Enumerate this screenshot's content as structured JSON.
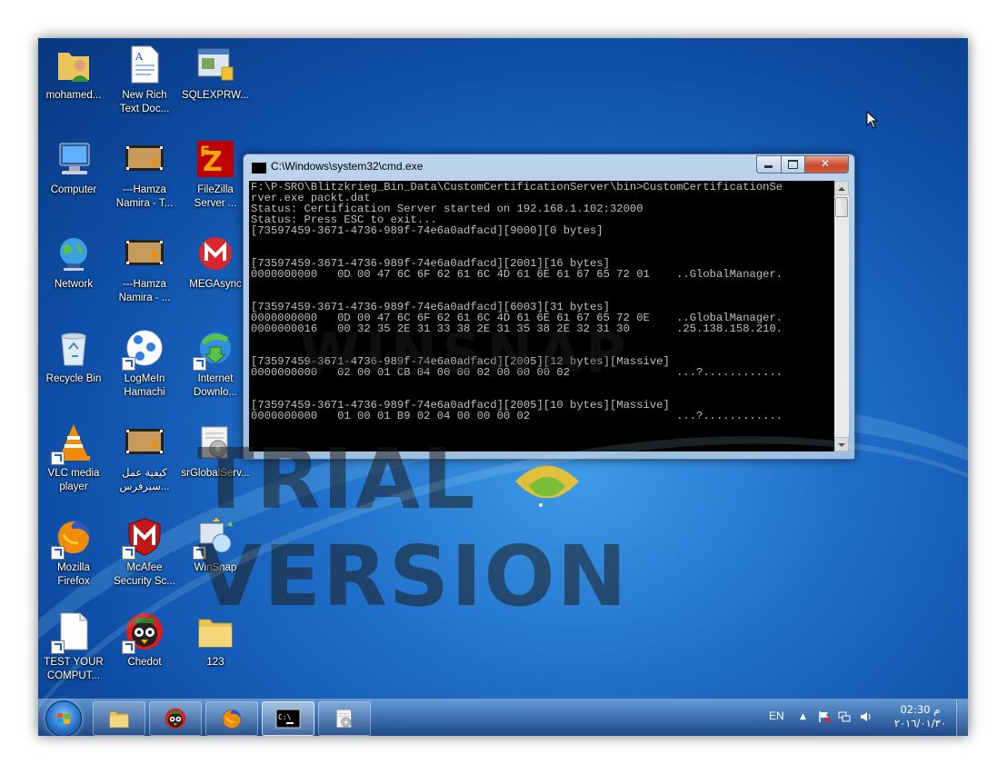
{
  "desktop": {
    "icons": [
      {
        "label": "mohamed...",
        "icon": "user-folder-icon"
      },
      {
        "label": "New Rich\nText Doc...",
        "icon": "rtf-document-icon"
      },
      {
        "label": "SQLEXPRW...",
        "icon": "sql-installer-icon"
      },
      {
        "label": "Computer",
        "icon": "computer-icon"
      },
      {
        "label": "---Hamza\nNamira - T...",
        "icon": "video-file-icon"
      },
      {
        "label": "FileZilla\nServer ...",
        "icon": "filezilla-icon"
      },
      {
        "label": "Network",
        "icon": "network-icon"
      },
      {
        "label": "---Hamza\nNamira - ...",
        "icon": "video-file-icon"
      },
      {
        "label": "MEGAsync",
        "icon": "megasync-icon"
      },
      {
        "label": "Recycle Bin",
        "icon": "recycle-bin-icon"
      },
      {
        "label": "LogMeIn\nHamachi",
        "icon": "hamachi-icon"
      },
      {
        "label": "Internet\nDownlo...",
        "icon": "internet-download-manager-icon"
      },
      {
        "label": "VLC media\nplayer",
        "icon": "vlc-icon"
      },
      {
        "label": "كيفية عمل\nسيرفرس...",
        "icon": "video-file-icon"
      },
      {
        "label": "srGlobalServ...",
        "icon": "server-config-icon"
      },
      {
        "label": "Mozilla\nFirefox",
        "icon": "firefox-icon"
      },
      {
        "label": "McAfee\nSecurity Sc...",
        "icon": "mcafee-icon"
      },
      {
        "label": "WinSnap",
        "icon": "winsnap-icon"
      },
      {
        "label": "TEST YOUR\nCOMPUT...",
        "icon": "blank-document-icon"
      },
      {
        "label": "Chedot",
        "icon": "chedot-icon"
      },
      {
        "label": "123",
        "icon": "folder-icon"
      }
    ]
  },
  "cmd_window": {
    "title": "C:\\Windows\\system32\\cmd.exe",
    "lines": [
      "F:\\P-SRO\\Blitzkrieg_Bin_Data\\CustomCertificationServer\\bin>CustomCertificationSe",
      "rver.exe packt.dat",
      "Status: Certification Server started on 192.168.1.102:32000",
      "Status: Press ESC to exit...",
      "[73597459-3671-4736-989f-74e6a0adfacd][9000][0 bytes]",
      "",
      "",
      "[73597459-3671-4736-989f-74e6a0adfacd][2001][16 bytes]",
      "0000000000   0D 00 47 6C 6F 62 61 6C 4D 61 6E 61 67 65 72 01    ..GlobalManager.",
      "",
      "",
      "[73597459-3671-4736-989f-74e6a0adfacd][6003][31 bytes]",
      "0000000000   0D 00 47 6C 6F 62 61 6C 4D 61 6E 61 67 65 72 0E    ..GlobalManager.",
      "0000000016   00 32 35 2E 31 33 38 2E 31 35 38 2E 32 31 30       .25.138.158.210.",
      "",
      "",
      "[73597459-3671-4736-989f-74e6a0adfacd][2005][12 bytes][Massive]",
      "0000000000   02 00 01 CB 04 00 00 02 00 00 00 02                ...?............",
      "",
      "",
      "[73597459-3671-4736-989f-74e6a0adfacd][2005][10 bytes][Massive]",
      "0000000000   01 00 01 B9 02 04 00 00 00 02                      ...?............"
    ]
  },
  "watermark": {
    "line1": "WINSNAP",
    "line2": "TRIAL VERSION"
  },
  "taskbar": {
    "buttons": [
      {
        "name": "explorer",
        "icon": "folder-icon",
        "active": false
      },
      {
        "name": "chedot",
        "icon": "chedot-icon",
        "active": false
      },
      {
        "name": "firefox",
        "icon": "firefox-icon",
        "active": false
      },
      {
        "name": "cmd",
        "icon": "command-prompt-icon",
        "active": true
      },
      {
        "name": "server-config",
        "icon": "server-config-icon",
        "active": false
      }
    ],
    "tray": {
      "language": "EN",
      "time": "02:30 م",
      "date": "٢٠١٦/٠١/٣٠"
    }
  }
}
